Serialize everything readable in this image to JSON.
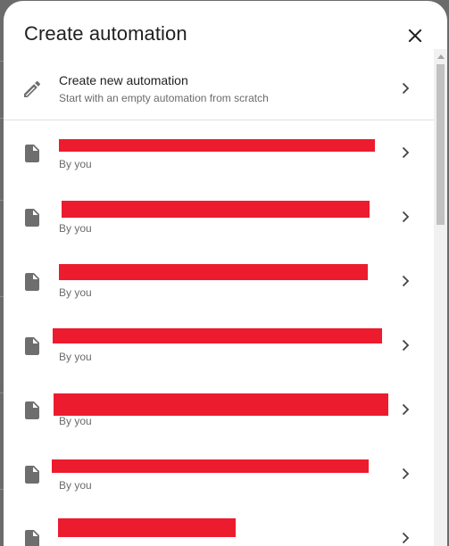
{
  "dialog": {
    "title": "Create automation",
    "close_icon": "close-icon"
  },
  "new_automation": {
    "label": "Create new automation",
    "description": "Start with an empty automation from scratch",
    "icon": "pencil-icon"
  },
  "automations": [
    {
      "owner": "By you",
      "icon": "document-icon"
    },
    {
      "owner": "By you",
      "icon": "document-icon"
    },
    {
      "owner": "By you",
      "icon": "document-icon"
    },
    {
      "owner": "By you",
      "icon": "document-icon"
    },
    {
      "owner": "By you",
      "icon": "document-icon"
    },
    {
      "owner": "By you",
      "icon": "document-icon"
    },
    {
      "owner": "",
      "icon": "document-icon"
    }
  ],
  "colors": {
    "redaction": "#ed1b2e",
    "text_primary": "#212121",
    "text_secondary": "#6b6b6b",
    "icon": "#6e6e6e"
  }
}
